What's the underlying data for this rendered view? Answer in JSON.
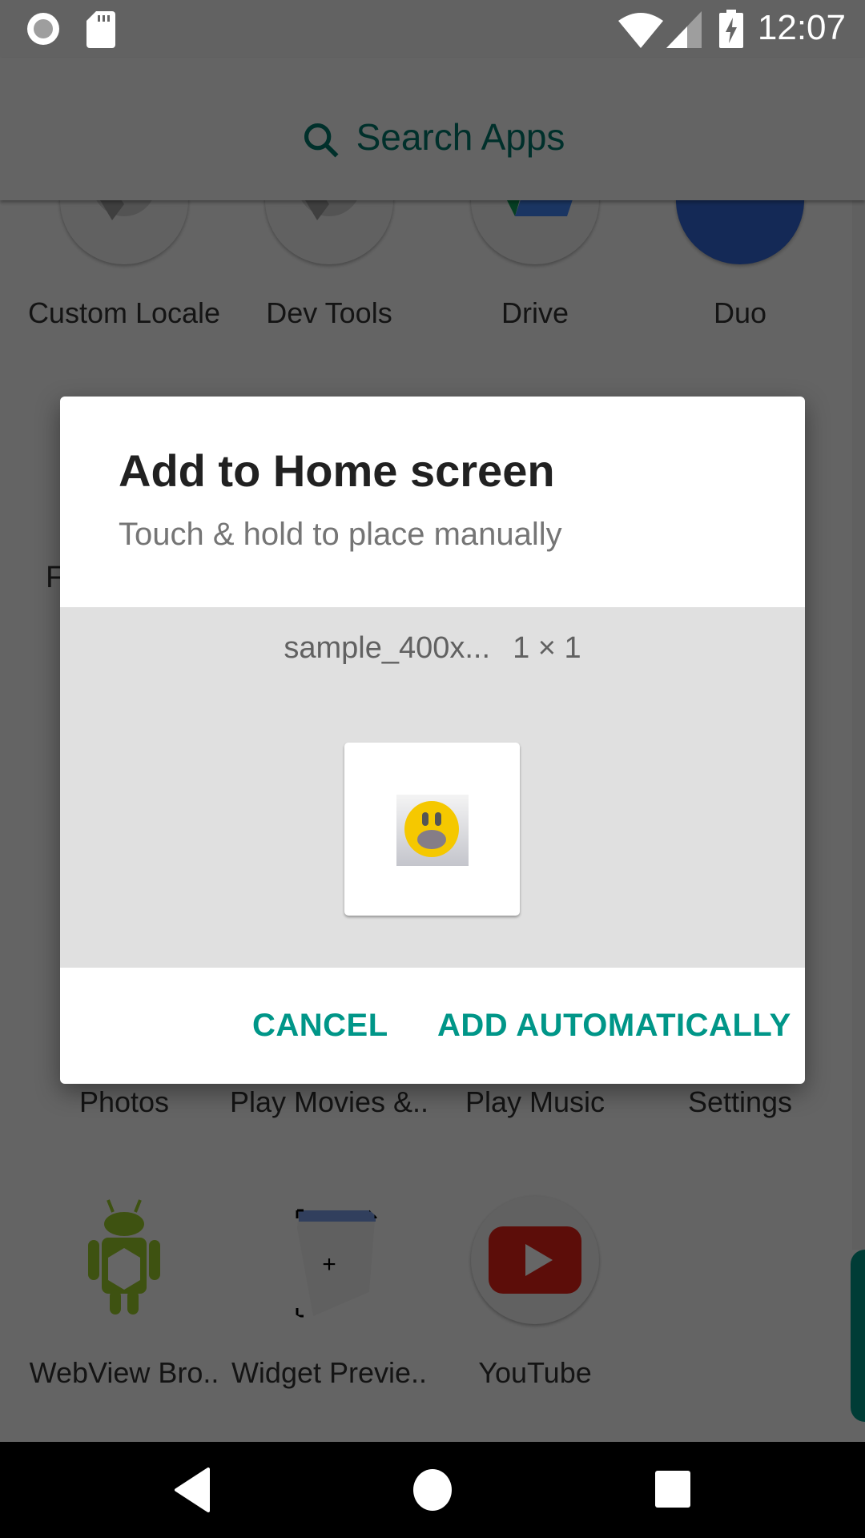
{
  "status_bar": {
    "time": "12:07",
    "left_icons": [
      "record-icon",
      "sd-card-icon"
    ],
    "right_icons": [
      "wifi-icon",
      "cell-signal-icon",
      "battery-charging-icon"
    ]
  },
  "launcher": {
    "search_placeholder": "Search Apps",
    "apps_row_1": [
      {
        "label": "Custom Locale",
        "icon": "custom-locale-icon"
      },
      {
        "label": "Dev Tools",
        "icon": "dev-tools-icon"
      },
      {
        "label": "Drive",
        "icon": "drive-icon"
      },
      {
        "label": "Duo",
        "icon": "duo-icon"
      }
    ],
    "section_letter": "F",
    "apps_row_3": [
      {
        "label": "Photos"
      },
      {
        "label": "Play Movies &.."
      },
      {
        "label": "Play Music"
      },
      {
        "label": "Settings"
      }
    ],
    "apps_row_4": [
      {
        "label": "WebView Bro..",
        "icon": "webview-browser-icon"
      },
      {
        "label": "Widget Previe..",
        "icon": "widget-preview-icon"
      },
      {
        "label": "YouTube",
        "icon": "youtube-icon"
      }
    ],
    "accent_color": "#009688"
  },
  "dialog": {
    "title": "Add to Home screen",
    "subtitle": "Touch & hold to place manually",
    "widget_name": "sample_400x...",
    "widget_size": "1 × 1",
    "buttons": {
      "cancel": "CANCEL",
      "add": "ADD AUTOMATICALLY"
    }
  },
  "nav_bar": {
    "buttons": [
      "back",
      "home",
      "recents"
    ]
  }
}
